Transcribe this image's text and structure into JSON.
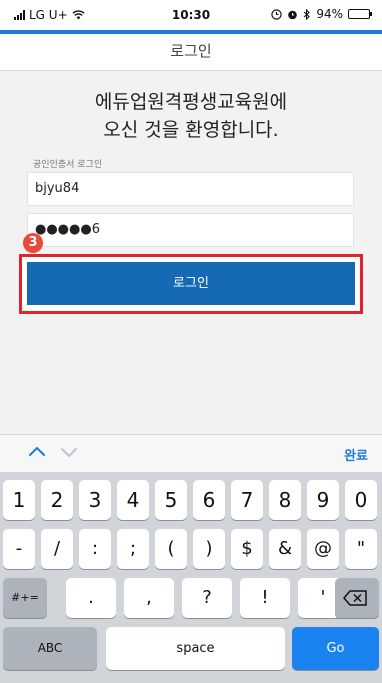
{
  "status_bar": {
    "carrier": "LG U+",
    "time": "10:30",
    "battery": "94%",
    "battery_level": 0.94,
    "icons": [
      "signal-icon",
      "wifi-icon",
      "clock-alarm-icon",
      "alarm-icon",
      "bluetooth-icon",
      "battery-icon"
    ]
  },
  "header": {
    "title": "로그인"
  },
  "main": {
    "welcome_line1": "에듀업원격평생교육원에",
    "welcome_line2": "오신 것을 환영합니다.",
    "cert_login_label": "공인인증서 로그인",
    "userid_value": "bjyu84",
    "password_value": "●●●●●6",
    "step_badge": "3",
    "login_button_label": "로그인"
  },
  "keyboard_accessory": {
    "done_label": "완료"
  },
  "keyboard": {
    "row1": [
      "1",
      "2",
      "3",
      "4",
      "5",
      "6",
      "7",
      "8",
      "9",
      "0"
    ],
    "row2": [
      "-",
      "/",
      ":",
      ";",
      "(",
      ")",
      "$",
      "&",
      "@",
      "\""
    ],
    "row3": [
      ".",
      ",",
      "?",
      "!",
      "'"
    ],
    "symbols_key": "#+=",
    "abc_key": "ABC",
    "space_key": "space",
    "go_key": "Go"
  },
  "colors": {
    "accent_blue": "#1e80d8",
    "login_button": "#166ab3",
    "highlight_red": "#e2232b",
    "badge_red": "#e8493a",
    "go_blue": "#1a83f0"
  }
}
